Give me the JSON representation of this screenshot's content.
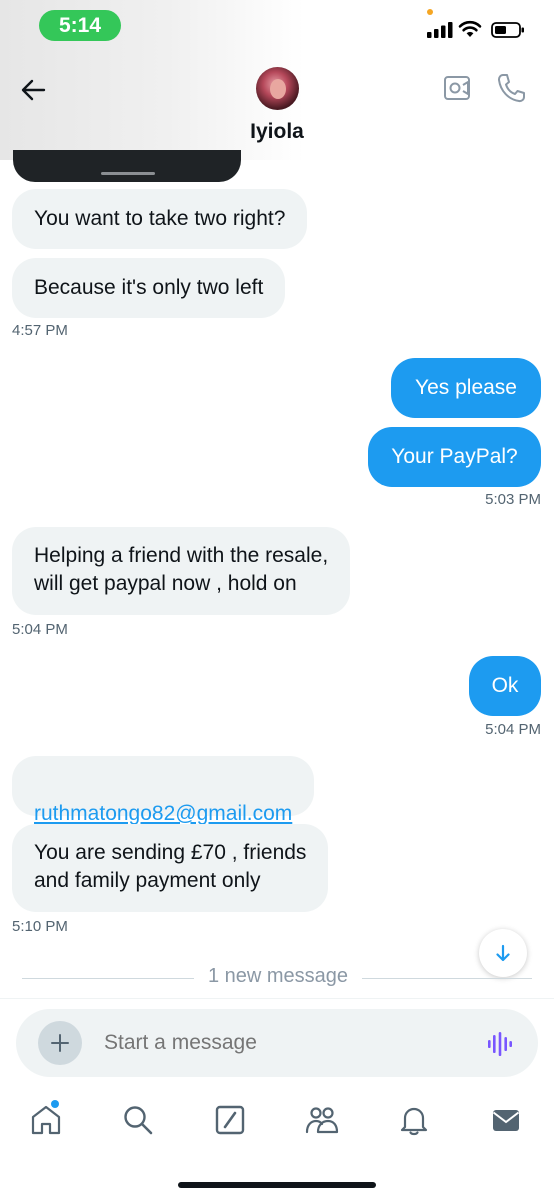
{
  "status_bar": {
    "time": "5:14"
  },
  "header": {
    "contact_name": "Iyiola"
  },
  "messages": [
    {
      "text": "You want to take two right?",
      "dir": "in"
    },
    {
      "text": "Because it's only two left",
      "dir": "in"
    },
    {
      "text": "Yes please",
      "dir": "out"
    },
    {
      "text": "Your PayPal?",
      "dir": "out"
    },
    {
      "text": "Helping a friend with the resale,\nwill get paypal now , hold on",
      "dir": "in"
    },
    {
      "text": "Ok",
      "dir": "out"
    },
    {
      "text": "ruthmatongo82@gmail.com",
      "dir": "in",
      "link": true
    },
    {
      "text": "You are sending £70 , friends\nand family payment only",
      "dir": "in"
    }
  ],
  "timestamps": [
    "4:57 PM",
    "5:03 PM",
    "5:04 PM",
    "5:04 PM",
    "5:10 PM"
  ],
  "new_message_divider": "1 new message",
  "composer": {
    "placeholder": "Start a message"
  },
  "tabs": [
    "home-icon",
    "search-icon",
    "grok-icon",
    "communities-icon",
    "notifications-icon",
    "messages-icon"
  ],
  "colors": {
    "accent": "#1d9bf0",
    "incoming_bubble": "#eff3f4",
    "status_green": "#34c759",
    "voice_purple": "#7856ff"
  }
}
